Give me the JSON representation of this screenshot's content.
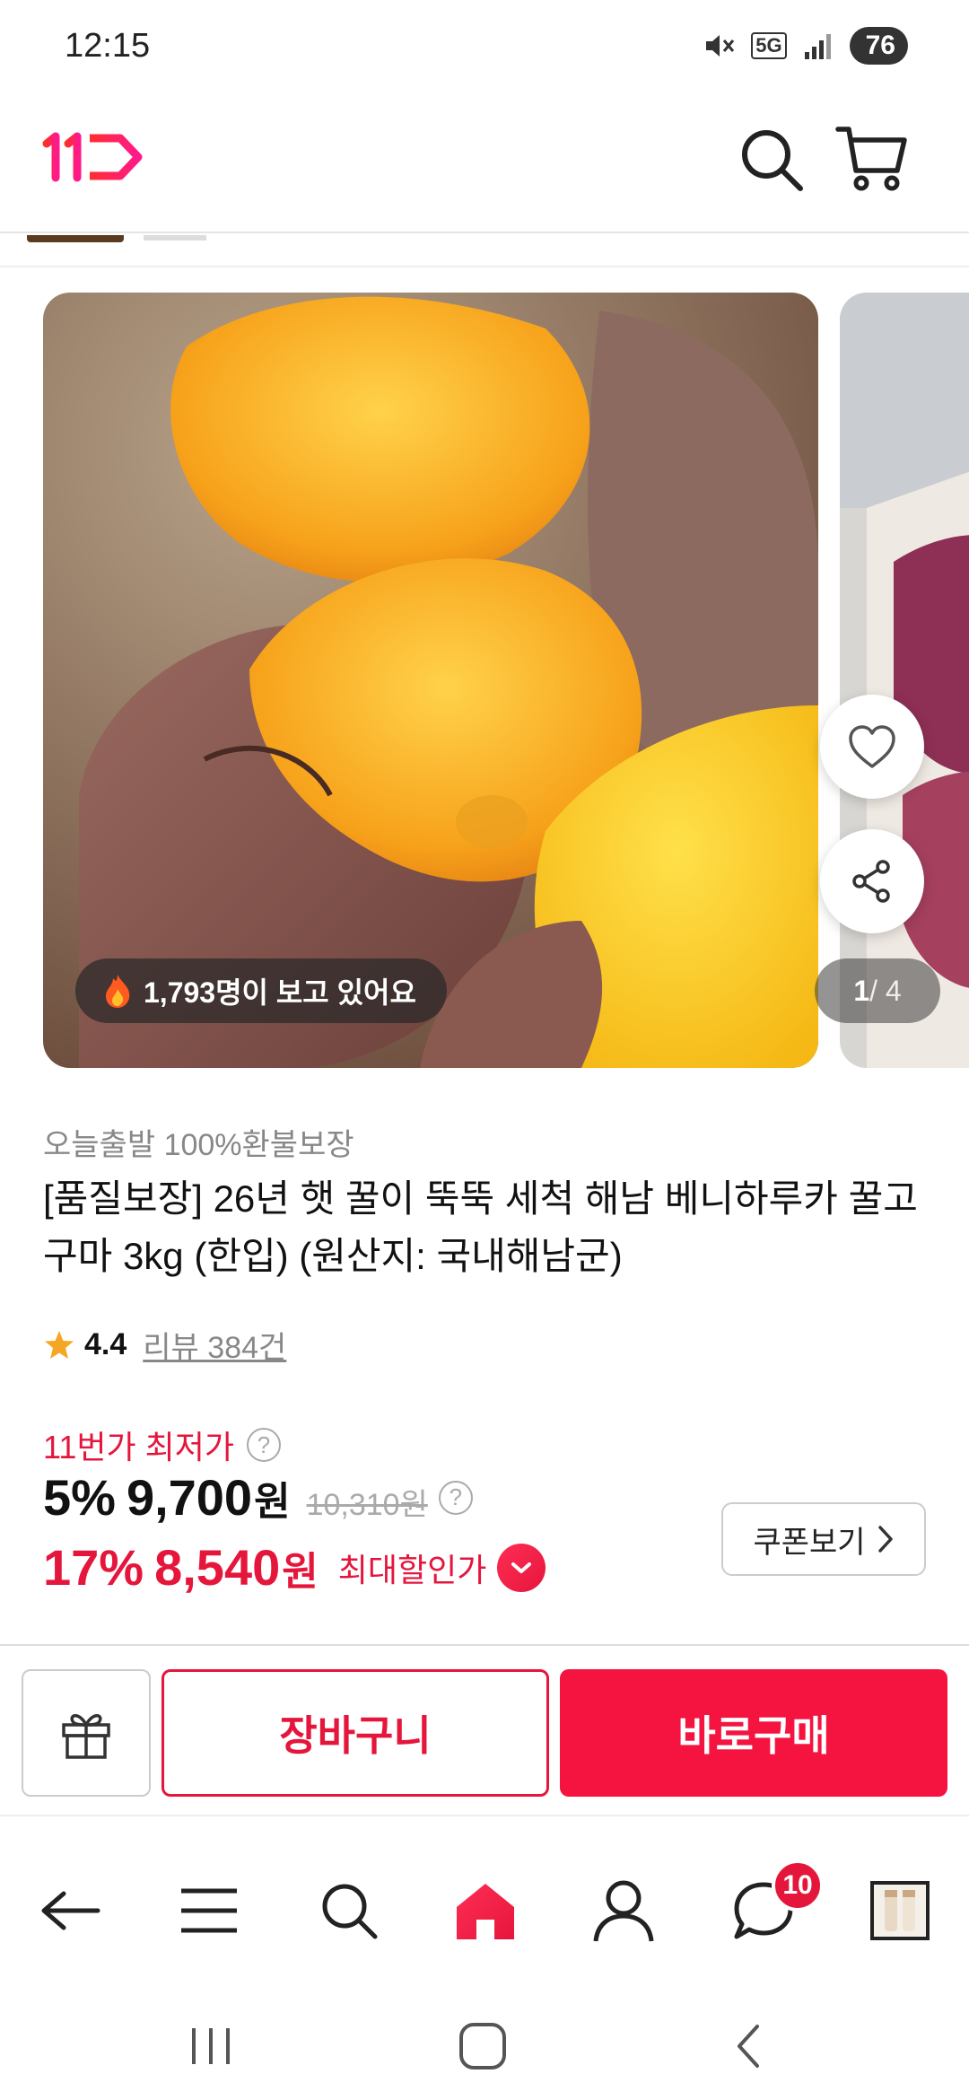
{
  "status_bar": {
    "time": "12:15",
    "network": "5G",
    "battery": "76"
  },
  "header": {
    "logo": "11",
    "search_icon": "search-icon",
    "cart_icon": "cart-icon"
  },
  "gallery": {
    "viewers_text": "1,793명이 보고 있어요",
    "counter_current": "1",
    "counter_total": " / 4"
  },
  "product": {
    "tagline": "오늘출발 100%환불보장",
    "title": "[품질보장] 26년 햇 꿀이 뚝뚝 세척 해남 베니하루카 꿀고구마 3kg (한입) (원산지: 국내해남군)",
    "rating": "4.4",
    "reviews": "리뷰 384건"
  },
  "price": {
    "lowest_label": "11번가 최저가",
    "discount1": "5%",
    "price1": "9,700",
    "won": "원",
    "original": "10,310원",
    "discount2": "17%",
    "price2": "8,540",
    "max_label": "최대할인가",
    "coupon_label": "쿠폰보기"
  },
  "actions": {
    "cart": "장바구니",
    "buy": "바로구매"
  },
  "bottom_nav": {
    "chat_badge": "10"
  },
  "colors": {
    "accent": "#e5163c",
    "brand_gradient": [
      "#ff2d55",
      "#e5163c"
    ]
  }
}
